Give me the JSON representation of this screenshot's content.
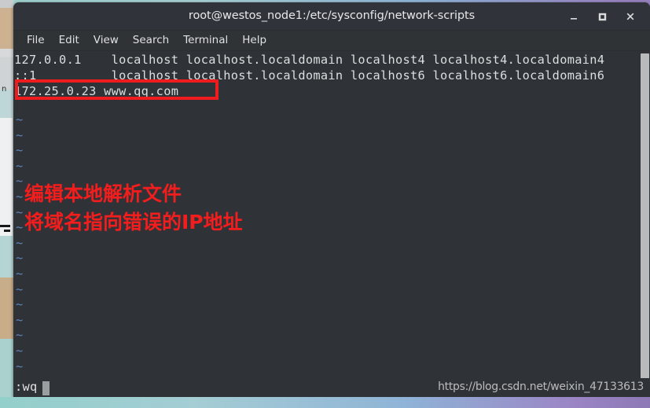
{
  "window": {
    "title": "root@westos_node1:/etc/sysconfig/network-scripts",
    "buttons": {
      "minimize": "minimize-button",
      "maximize": "maximize-button",
      "close": "close-button"
    }
  },
  "menubar": {
    "items": [
      {
        "label": "File"
      },
      {
        "label": "Edit"
      },
      {
        "label": "View"
      },
      {
        "label": "Search"
      },
      {
        "label": "Terminal"
      },
      {
        "label": "Help"
      }
    ]
  },
  "editor": {
    "lines": [
      "127.0.0.1    localhost localhost.localdomain localhost4 localhost4.localdomain4",
      "::1          localhost localhost.localdomain localhost6 localhost6.localdomain6",
      "172.25.0.23 www.qq.com"
    ],
    "empty_marker": "~",
    "empty_marker_count": 18,
    "highlight_color": "#ee1c1c"
  },
  "annotations": [
    {
      "text": "编辑本地解析文件",
      "color": "#f41d1d"
    },
    {
      "text": "将域名指向错误的IP地址",
      "color": "#f41d1d"
    }
  ],
  "status": {
    "command": ":wq",
    "watermark": "https://blog.csdn.net/weixin_47133613"
  }
}
